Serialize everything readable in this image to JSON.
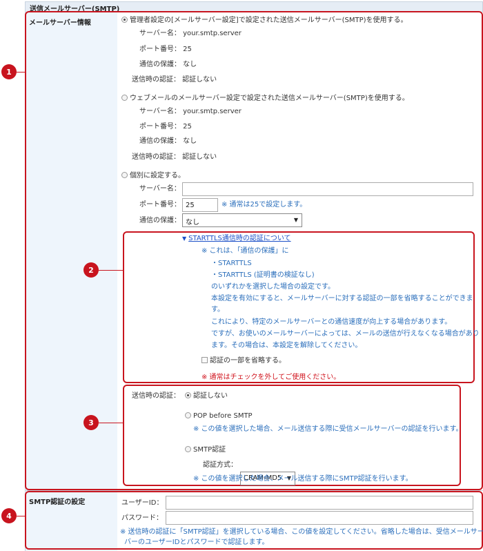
{
  "header": {
    "title": "送信メールサーバー(SMTP)"
  },
  "mail_server": {
    "label": "メールサーバー情報",
    "option_admin": {
      "label": "管理者設定の[メールサーバー設定]で設定された送信メールサーバー(SMTP)を使用する。",
      "server": "サーバー名： your.smtp.server",
      "port": "ポート番号： 25",
      "security": "通信の保護： なし",
      "auth": "送信時の認証： 認証しない",
      "checked": true
    },
    "option_webmail": {
      "label": "ウェブメールのメールサーバー設定で設定された送信メールサーバー(SMTP)を使用する。",
      "server": "サーバー名： your.smtp.server",
      "port": "ポート番号： 25",
      "security": "通信の保護： なし",
      "auth": "送信時の認証： 認証しない",
      "checked": false
    },
    "option_custom": {
      "label": "個別に設定する。",
      "server_label": "サーバー名：",
      "server_value": "",
      "port_label": "ポート番号：",
      "port_value": "25",
      "port_note": "※ 通常は25で設定します。",
      "security_label": "通信の保護：",
      "security_value": "なし",
      "checked": false
    }
  },
  "starttls": {
    "link": "STARTTLS通信時の認証について",
    "lines": [
      "※ これは、「通信の保護」に",
      "・STARTTLS",
      "・STARTTLS (証明書の検証なし)",
      "のいずれかを選択した場合の設定です。",
      "本設定を有効にすると、メールサーバーに対する認証の一部を省略することができま",
      "す。",
      "これにより、特定のメールサーバーとの通信速度が向上する場合があります。",
      "ですが、お使いのメールサーバーによっては、メールの送信が行えなくなる場合があり",
      "ます。その場合は、本設定を解除してください。"
    ],
    "checkbox_label": "認証の一部を省略する。",
    "warning": "※ 通常はチェックを外してご使用ください。"
  },
  "auth": {
    "label": "送信時の認証：",
    "none": "認証しない",
    "pop": "POP before SMTP",
    "pop_note": "※ この値を選択した場合、メール送信する際に受信メールサーバーの認証を行います。",
    "smtp": "SMTP認証",
    "method_label": "認証方式：",
    "method_value": "CRAM-MD5",
    "smtp_note": "※ この値を選択した場合、メール送信する際にSMTP認証を行います。"
  },
  "smtp_auth": {
    "label": "SMTP認証の設定",
    "user_label": "ユーザーID：",
    "user_value": "",
    "pass_label": "パスワード：",
    "pass_value": "",
    "note_1": "※ 送信時の認証に「SMTP認証」を選択している場合、この値を設定してください。省略した場合は、受信メールサー",
    "note_2": "バーのユーザーIDとパスワードで認証します。"
  },
  "badges": [
    "1",
    "2",
    "3",
    "4"
  ]
}
